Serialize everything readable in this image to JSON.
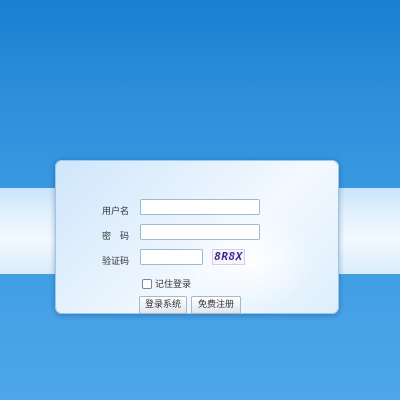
{
  "login": {
    "username_label": "用户名",
    "password_label": "密　码",
    "captcha_label": "验证码",
    "username_value": "",
    "password_value": "",
    "captcha_value": "",
    "captcha_text": "8R8X",
    "remember_label": "记住登录",
    "login_button": "登录系统",
    "register_button": "免费注册"
  }
}
